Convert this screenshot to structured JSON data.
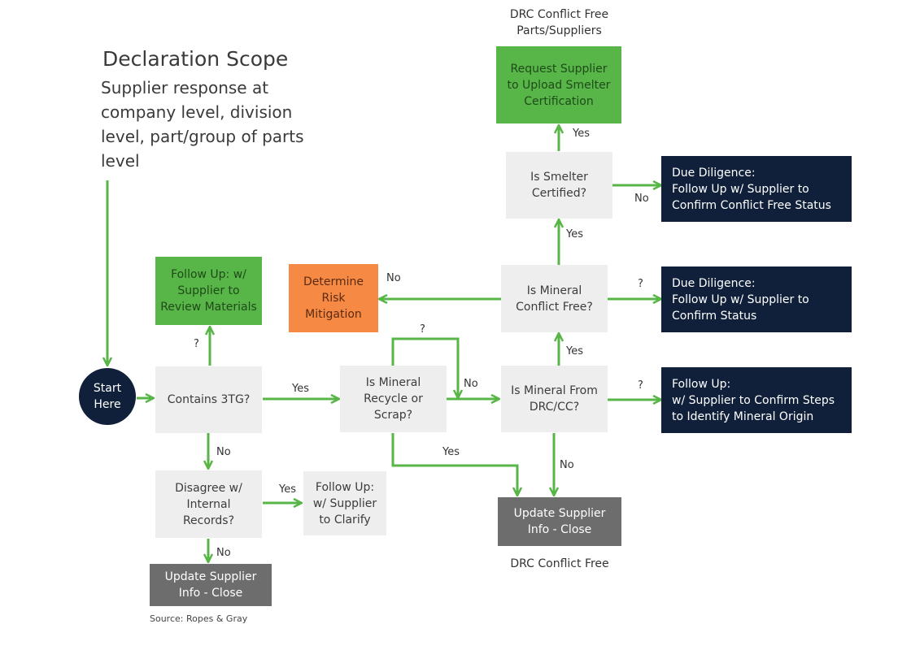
{
  "heading": {
    "title": "Declaration Scope",
    "subtitle": "Supplier response at\ncompany level, division\nlevel, part/group of parts\nlevel"
  },
  "colors": {
    "arrow": "#58b547",
    "decision": "#eeeeef",
    "green_action": "#58b547",
    "orange_action": "#f68a45",
    "navy_action": "#10203a",
    "gray_close": "#6d6d6d"
  },
  "nodes": {
    "start": "Start\nHere",
    "contains_3tg": "Contains 3TG?",
    "follow_up_review": "Follow Up: w/\nSupplier to\nReview Materials",
    "disagree_records": "Disagree w/\nInternal\nRecords?",
    "follow_up_clarify": "Follow Up:\nw/ Supplier\nto Clarify",
    "update_close_left": "Update Supplier\nInfo - Close",
    "recycle_scrap": "Is Mineral\nRecycle or\nScrap?",
    "from_drc": "Is Mineral From\nDRC/CC?",
    "conflict_free": "Is Mineral\nConflict Free?",
    "risk_mitigation": "Determine\nRisk\nMitigation",
    "smelter_certified": "Is Smelter\nCertified?",
    "request_smelter_cert": "Request Supplier\nto Upload Smelter\nCertification",
    "due_diligence_conflict_free": "Due Diligence:\nFollow Up w/ Supplier to\nConfirm Conflict Free Status",
    "due_diligence_status": "Due Diligence:\nFollow Up w/ Supplier to\nConfirm Status",
    "follow_up_origin": "Follow Up:\n w/ Supplier to Confirm Steps\nto Identify Mineral Origin",
    "update_close_right": "Update Supplier\nInfo - Close"
  },
  "captions": {
    "top": "DRC Conflict Free\nParts/Suppliers",
    "bottom": "DRC Conflict Free",
    "source": "Source: Ropes & Gray"
  },
  "edge_labels": {
    "q_review": "?",
    "yes_recycle": "Yes",
    "no_disagree": "No",
    "yes_clarify": "Yes",
    "no_close_left": "No",
    "q_recycle_loop": "?",
    "no_recycle": "No",
    "yes_recycle_close": "Yes",
    "no_drc_close": "No",
    "yes_drc_conflict": "Yes",
    "q_drc_origin": "?",
    "no_risk": "No",
    "q_conflict_status": "?",
    "yes_conflict_smelter": "Yes",
    "no_smelter": "No",
    "yes_smelter_request": "Yes"
  }
}
